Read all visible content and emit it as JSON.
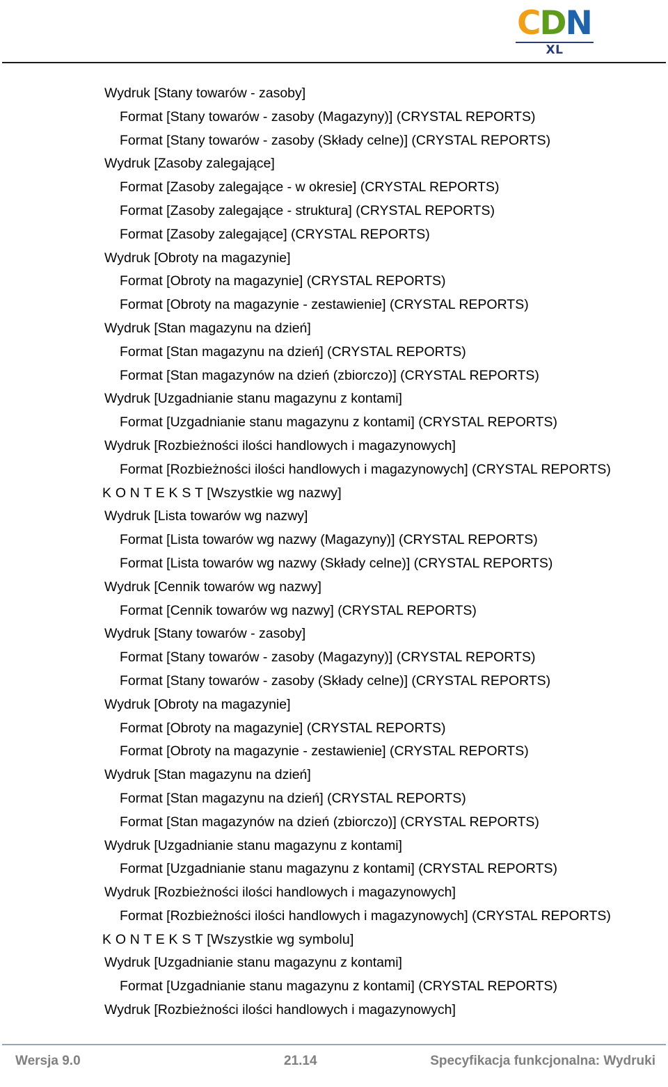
{
  "document": {
    "title": "Specyfikacja funkcjonalna: Wydruki"
  },
  "header": {
    "logo": {
      "name": "CDN XL",
      "letter_c": "C",
      "letter_d": "D",
      "letter_n": "N",
      "subtitle": "XL",
      "color_c": "#f0a016",
      "color_d": "#5f9c1e",
      "color_n": "#1f63ab",
      "color_subtitle": "#2b3c73"
    }
  },
  "content": {
    "lines": [
      {
        "level": "wydruk",
        "text": "Wydruk [Stany towarów - zasoby]"
      },
      {
        "level": "format",
        "text": "Format [Stany towarów - zasoby (Magazyny)] (CRYSTAL REPORTS)"
      },
      {
        "level": "format",
        "text": "Format [Stany towarów - zasoby (Składy celne)] (CRYSTAL REPORTS)"
      },
      {
        "level": "wydruk",
        "text": "Wydruk [Zasoby zalegające]"
      },
      {
        "level": "format",
        "text": "Format [Zasoby zalegające - w okresie] (CRYSTAL REPORTS)"
      },
      {
        "level": "format",
        "text": "Format [Zasoby zalegające - struktura] (CRYSTAL REPORTS)"
      },
      {
        "level": "format",
        "text": "Format [Zasoby zalegające] (CRYSTAL REPORTS)"
      },
      {
        "level": "wydruk",
        "text": "Wydruk [Obroty na magazynie]"
      },
      {
        "level": "format",
        "text": "Format [Obroty na magazynie] (CRYSTAL REPORTS)"
      },
      {
        "level": "format",
        "text": "Format [Obroty na magazynie - zestawienie] (CRYSTAL REPORTS)"
      },
      {
        "level": "wydruk",
        "text": "Wydruk [Stan magazynu na dzień]"
      },
      {
        "level": "format",
        "text": "Format [Stan magazynu na dzień] (CRYSTAL REPORTS)"
      },
      {
        "level": "format",
        "text": "Format [Stan magazynów na dzień (zbiorczo)] (CRYSTAL REPORTS)"
      },
      {
        "level": "wydruk",
        "text": "Wydruk [Uzgadnianie stanu magazynu z kontami]"
      },
      {
        "level": "format",
        "text": "Format [Uzgadnianie stanu magazynu z kontami] (CRYSTAL REPORTS)"
      },
      {
        "level": "wydruk",
        "text": "Wydruk [Rozbieżności ilości handlowych i magazynowych]"
      },
      {
        "level": "format",
        "text": "Format [Rozbieżności ilości handlowych i magazynowych] (CRYSTAL REPORTS)"
      },
      {
        "level": "context",
        "text": "K O N T E K S T [Wszystkie wg nazwy]"
      },
      {
        "level": "wydruk",
        "text": "Wydruk [Lista towarów wg nazwy]"
      },
      {
        "level": "format",
        "text": "Format [Lista towarów wg nazwy (Magazyny)] (CRYSTAL REPORTS)"
      },
      {
        "level": "format",
        "text": "Format [Lista towarów wg nazwy (Składy celne)] (CRYSTAL REPORTS)"
      },
      {
        "level": "wydruk",
        "text": "Wydruk [Cennik towarów wg nazwy]"
      },
      {
        "level": "format",
        "text": "Format [Cennik towarów wg nazwy] (CRYSTAL REPORTS)"
      },
      {
        "level": "wydruk",
        "text": "Wydruk [Stany towarów - zasoby]"
      },
      {
        "level": "format",
        "text": "Format [Stany towarów - zasoby (Magazyny)] (CRYSTAL REPORTS)"
      },
      {
        "level": "format",
        "text": "Format [Stany towarów - zasoby (Składy celne)] (CRYSTAL REPORTS)"
      },
      {
        "level": "wydruk",
        "text": "Wydruk [Obroty na magazynie]"
      },
      {
        "level": "format",
        "text": "Format [Obroty na magazynie] (CRYSTAL REPORTS)"
      },
      {
        "level": "format",
        "text": "Format [Obroty na magazynie - zestawienie] (CRYSTAL REPORTS)"
      },
      {
        "level": "wydruk",
        "text": "Wydruk [Stan magazynu na dzień]"
      },
      {
        "level": "format",
        "text": "Format [Stan magazynu na dzień] (CRYSTAL REPORTS)"
      },
      {
        "level": "format",
        "text": "Format [Stan magazynów na dzień (zbiorczo)] (CRYSTAL REPORTS)"
      },
      {
        "level": "wydruk",
        "text": "Wydruk [Uzgadnianie stanu magazynu z kontami]"
      },
      {
        "level": "format",
        "text": "Format [Uzgadnianie stanu magazynu z kontami] (CRYSTAL REPORTS)"
      },
      {
        "level": "wydruk",
        "text": "Wydruk [Rozbieżności ilości handlowych i magazynowych]"
      },
      {
        "level": "format",
        "text": "Format [Rozbieżności ilości handlowych i magazynowych] (CRYSTAL REPORTS)"
      },
      {
        "level": "context",
        "text": "K O N T E K S T [Wszystkie wg symbolu]"
      },
      {
        "level": "wydruk",
        "text": "Wydruk [Uzgadnianie stanu magazynu z kontami]"
      },
      {
        "level": "format",
        "text": "Format [Uzgadnianie stanu magazynu z kontami] (CRYSTAL REPORTS)"
      },
      {
        "level": "wydruk",
        "text": "Wydruk [Rozbieżności ilości handlowych i magazynowych]"
      }
    ]
  },
  "footer": {
    "version": "Wersja 9.0",
    "page_number": "21.14",
    "document_title": "Specyfikacja funkcjonalna: Wydruki",
    "text_color": "#808080"
  }
}
